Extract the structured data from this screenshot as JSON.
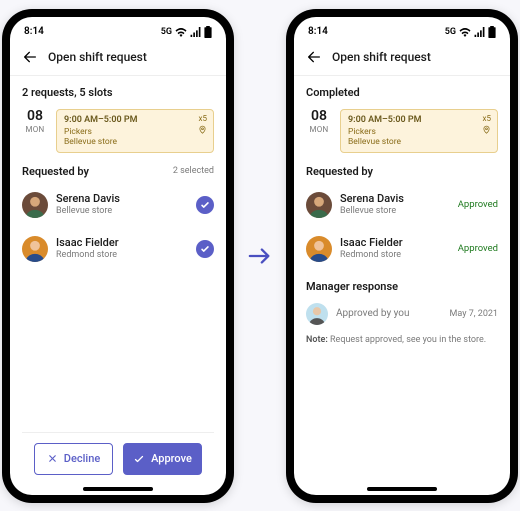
{
  "status": {
    "time": "8:14",
    "net": "5G"
  },
  "header": {
    "title": "Open shift request"
  },
  "left": {
    "summary": "2 requests, 5 slots",
    "date": {
      "num": "08",
      "dow": "MON"
    },
    "shift": {
      "time": "9:00 AM–5:00 PM",
      "role": "Pickers",
      "loc": "Bellevue store",
      "qty": "x5"
    },
    "req_title": "Requested by",
    "req_meta": "2 selected",
    "people": [
      {
        "name": "Serena Davis",
        "loc": "Bellevue store"
      },
      {
        "name": "Isaac Fielder",
        "loc": "Redmond store"
      }
    ],
    "actions": {
      "decline": "Decline",
      "approve": "Approve"
    }
  },
  "right": {
    "summary": "Completed",
    "date": {
      "num": "08",
      "dow": "MON"
    },
    "shift": {
      "time": "9:00 AM–5:00 PM",
      "role": "Pickers",
      "loc": "Bellevue store",
      "qty": "x5"
    },
    "req_title": "Requested by",
    "people": [
      {
        "name": "Serena Davis",
        "loc": "Bellevue store",
        "status": "Approved"
      },
      {
        "name": "Isaac Fielder",
        "loc": "Redmond store",
        "status": "Approved"
      }
    ],
    "mgr_title": "Manager response",
    "mgr_text": "Approved by you",
    "mgr_date": "May 7, 2021",
    "note_label": "Note:",
    "note_text": " Request approved, see you in the store."
  }
}
